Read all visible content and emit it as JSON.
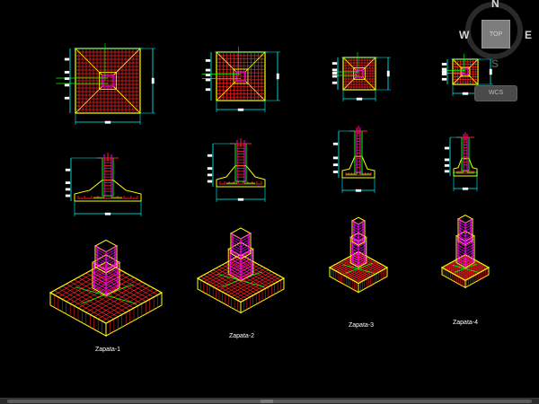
{
  "viewcube": {
    "north": "N",
    "south": "S",
    "east": "E",
    "west": "W",
    "face": "TOP",
    "wcs": "WCS"
  },
  "footings": [
    {
      "caption": "Zapata-1"
    },
    {
      "caption": "Zapata-2"
    },
    {
      "caption": "Zapata-3"
    },
    {
      "caption": "Zapata-4"
    }
  ],
  "colors": {
    "background": "#000000",
    "rebar": "#ff2020",
    "outline": "#ffff00",
    "column_bars": "#ff00ff",
    "dimension": "#00ffff",
    "pedestal": "#00ff00",
    "text": "#ffffff"
  },
  "icons": {
    "viewcube": "viewcube-icon",
    "compass": "compass-ring-icon"
  }
}
